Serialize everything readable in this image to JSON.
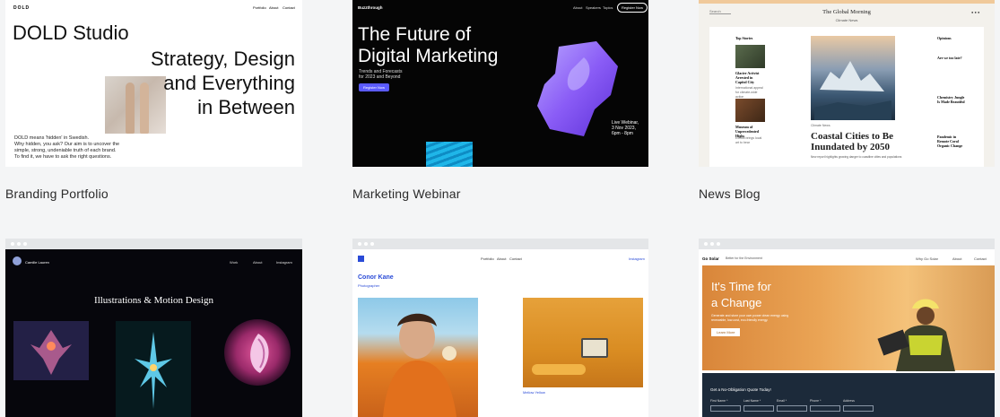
{
  "templates": [
    {
      "caption": "Branding Portfolio",
      "logo": "DOLD",
      "nav": [
        "Portfolio",
        "About",
        "Contact"
      ],
      "title": "DOLD Studio",
      "headline": [
        "Strategy, Design",
        "and Everything",
        "in Between"
      ],
      "body": [
        "DOLD means 'hidden' in Swedish.",
        "Why hidden, you ask? Our aim is to uncover the",
        "simple, strong, undeniable truth of each brand.",
        "To find it, we have to ask the right questions."
      ]
    },
    {
      "caption": "Marketing Webinar",
      "logo": "Buzzthrough",
      "nav": [
        "About",
        "Speakers",
        "Topics"
      ],
      "nav_button": "Register Now",
      "title": [
        "The Future of",
        "Digital Marketing"
      ],
      "subtitle": [
        "Trends and Forecasts",
        "for 2023 and Beyond"
      ],
      "cta": "Register Now",
      "event": [
        "Live Webinar,",
        "3 Nov 2023,",
        "6pm - 8pm"
      ]
    },
    {
      "caption": "News Blog",
      "masthead": "The Global Morning",
      "masthead_sub": "Climate News",
      "search": "Search",
      "left_heading": "Top Stories",
      "left_items": [
        {
          "title": "Glacier Activist Arrested in Capitol City",
          "text": "International appeal for climate-wide action"
        },
        {
          "title": "Museum of Unprecedented Highs",
          "text": "Exhibit brings local art to bear"
        }
      ],
      "center_tag": "Climate  News",
      "headline": [
        "Coastal Cities to Be",
        "Inundated by 2050"
      ],
      "center_text": "New report highlights growing danger to coastline cities and populations",
      "right_heading": "Opinions",
      "right_items": [
        "Are we too late?",
        "Chemistry Jungle Is Made Beautiful",
        "Pandemic in Remote Coral Organic Change"
      ]
    },
    {
      "name": "Camille Lauren",
      "nav": [
        "Work",
        "About",
        "Instagram"
      ],
      "title": "Illustrations & Motion Design"
    },
    {
      "name": "Conor Kane",
      "subtitle": "Photographer",
      "nav": [
        "Portfolio",
        "About",
        "Contact"
      ],
      "social": "Instagram",
      "tile_label": "Mellow Yellow"
    },
    {
      "logo": "Go Solar",
      "tagline": "Better for the Environment",
      "nav": [
        "Why Go Solar",
        "About",
        "Contact"
      ],
      "title": [
        "It's Time for",
        "a Change"
      ],
      "body": [
        "Generate and store your own power clean energy using",
        "renewable, low-cost, eco-friendly energy."
      ],
      "cta": "Learn More",
      "form_title": "Get a No-Obligation Quote Today!",
      "fields": [
        "First Name *",
        "Last Name *",
        "Email *",
        "Phone *",
        "Address"
      ]
    }
  ],
  "colors": {
    "background": "#f4f5f6",
    "webinar_accent": "#5b5bff",
    "solar_orange": "#e9a64a",
    "conor_blue": "#2a4bd7"
  }
}
